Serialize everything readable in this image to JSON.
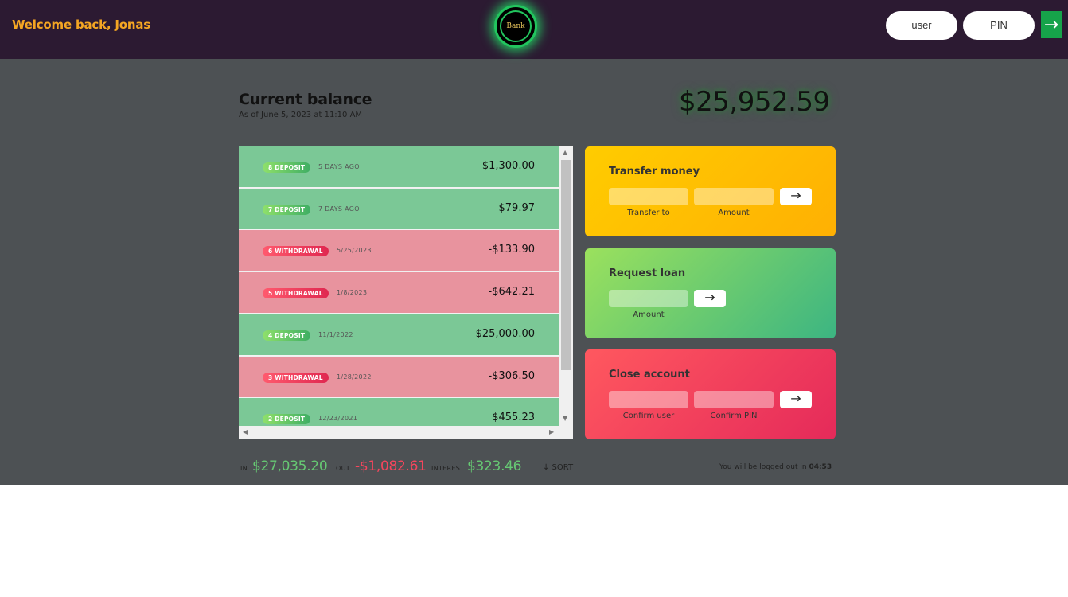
{
  "nav": {
    "welcome": "Welcome back, Jonas",
    "logo_text": "Bank",
    "user_placeholder": "user",
    "pin_placeholder": "PIN",
    "login_arrow": "→"
  },
  "balance": {
    "label": "Current balance",
    "date": "As of June 5, 2023 at 11:10 AM",
    "value": "$25,952.59"
  },
  "movements": [
    {
      "type": "deposit",
      "type_label": "8 DEPOSIT",
      "date": "5 DAYS AGO",
      "value": "$1,300.00"
    },
    {
      "type": "deposit",
      "type_label": "7 DEPOSIT",
      "date": "7 DAYS AGO",
      "value": "$79.97"
    },
    {
      "type": "withdrawal",
      "type_label": "6 WITHDRAWAL",
      "date": "5/25/2023",
      "value": "-$133.90"
    },
    {
      "type": "withdrawal",
      "type_label": "5 WITHDRAWAL",
      "date": "1/8/2023",
      "value": "-$642.21"
    },
    {
      "type": "deposit",
      "type_label": "4 DEPOSIT",
      "date": "11/1/2022",
      "value": "$25,000.00"
    },
    {
      "type": "withdrawal",
      "type_label": "3 WITHDRAWAL",
      "date": "1/28/2022",
      "value": "-$306.50"
    },
    {
      "type": "deposit",
      "type_label": "2 DEPOSIT",
      "date": "12/23/2021",
      "value": "$455.23"
    }
  ],
  "operations": {
    "transfer": {
      "title": "Transfer money",
      "label_to": "Transfer to",
      "label_amount": "Amount",
      "button": "→"
    },
    "loan": {
      "title": "Request loan",
      "label_amount": "Amount",
      "button": "→"
    },
    "close": {
      "title": "Close account",
      "label_user": "Confirm user",
      "label_pin": "Confirm PIN",
      "button": "→"
    }
  },
  "summary": {
    "in_label": "IN",
    "in_value": "$27,035.20",
    "out_label": "OUT",
    "out_value": "-$1,082.61",
    "interest_label": "INTEREST",
    "interest_value": "$323.46",
    "sort": "↓ SORT",
    "timer_text": "You will be logged out in",
    "timer_value": "04:53"
  },
  "colors": {
    "deposit": "#7bc896",
    "withdrawal": "#e8939e",
    "accent": "#f5a623"
  }
}
